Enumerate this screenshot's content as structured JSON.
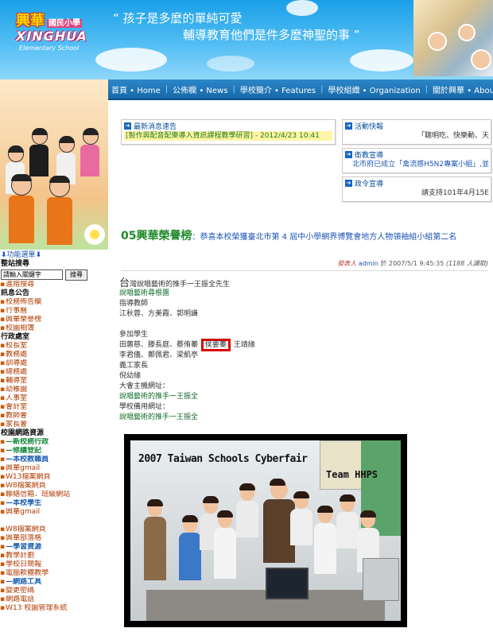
{
  "header": {
    "logo_cn": "興華",
    "logo_cn_small": "國民小學",
    "logo_en": "XINGHUA",
    "logo_sub": "Elementary School",
    "slogan_line1": "“ 孩子是多麼的單純可愛",
    "slogan_line2": "輔導教育他們是件多麼神聖的事 ”"
  },
  "topnav": {
    "items": [
      "首頁 • Home",
      "公佈欄 • News",
      "學校簡介 • Features",
      "學校組織 • Organization",
      "關於興華 • About"
    ]
  },
  "left_nav": {
    "function_menu": "功能選單",
    "site_search": "整站搜尋",
    "search_placeholder": "請輸入關鍵字",
    "search_button": "搜尋",
    "advanced_search": "進階搜尋",
    "info_section": "訊息公告",
    "info_items": [
      "校務佈告欄",
      "行事曆",
      "興華榮譽榜",
      "校園相簿"
    ],
    "admin_section": "行政處室",
    "admin_items": [
      "校長室",
      "教務處",
      "訓導處",
      "總務處",
      "輔導室",
      "幼稚園",
      "人事室",
      "會計室",
      "教師會",
      "家長會"
    ],
    "network_section": "校園網路資源",
    "network_items": [
      {
        "text": "—新校務行政",
        "style": "green"
      },
      {
        "text": "—修繕登記",
        "style": "green"
      },
      {
        "text": "—本校教職員",
        "style": "blue"
      },
      {
        "text": "興華gmail",
        "style": "plain"
      },
      {
        "text": "W13檔案網頁",
        "style": "plain"
      },
      {
        "text": "W8檔案網頁",
        "style": "plain"
      },
      {
        "text": "聯絡信箱．班級網站",
        "style": "plain"
      },
      {
        "text": "—本校學生",
        "style": "blue"
      },
      {
        "text": "興華gmail",
        "style": "plain"
      },
      {
        "text": "",
        "style": "plain"
      },
      {
        "text": "W8檔案網頁",
        "style": "plain"
      },
      {
        "text": "興華部落格",
        "style": "plain"
      },
      {
        "text": "—學習資源",
        "style": "blue"
      },
      {
        "text": "教學計劃",
        "style": "plain"
      },
      {
        "text": "學校日簡報",
        "style": "plain"
      },
      {
        "text": "電腦軟體教學",
        "style": "plain"
      },
      {
        "text": "—網路工具",
        "style": "blue"
      },
      {
        "text": "變更密碼",
        "style": "plain"
      },
      {
        "text": "網路電話",
        "style": "plain"
      },
      {
        "text": "W13 校園管理系統",
        "style": "plain"
      }
    ]
  },
  "news_box": {
    "title": "最新消息速告",
    "ticker": "[製作與配音配樂導入資訊課程教學研習] - 2012/4/23 10:41"
  },
  "activity_box": {
    "title": "活動快報",
    "text": "「聰明吃、快樂動、天"
  },
  "health_box": {
    "title": "衛教宣導",
    "text": "北市府已成立「禽流感H5N2專案小組」,並"
  },
  "gov_box": {
    "title": "政令宣導",
    "text": "請支持101年4月15E"
  },
  "article": {
    "title_num": "05興華榮譽榜",
    "title_sep": "：",
    "title_rest": "恭喜本校榮獲臺北市第 4 屆中小學網界博覽會地方人物領袖組小組第二名",
    "meta_poster": "發表人",
    "meta_author": "admin",
    "meta_at": "於 2007/5/1 9:45:35",
    "meta_reads": "(1188 人讀取)",
    "dropcap": "台",
    "line1_rest": "灣說唱藝術的推手一王振全先生",
    "line2": "說唱藝術尋根團",
    "line3": "指導教師",
    "line4": "江秋蓉、方美霞、郭明謙",
    "line6": "參加學生",
    "line7_a": "田蕙慈、滕長庭、蔡侑蓁",
    "line7_hl": "侯要蓁",
    "line7_b": "王靖緣",
    "line8": "李君儀、鄭佩君、梁凱亭",
    "line9": "義工家長",
    "line10": "倪幼緣",
    "line11": "大會主機網址：",
    "line12": "說唱藝術的推手一王振全",
    "line13": "學校備用網址：",
    "line14": "說唱藝術的推手一王振全"
  },
  "photo": {
    "caption": "2007 Taiwan Schools Cyberfair",
    "team": "Team HHPS"
  }
}
